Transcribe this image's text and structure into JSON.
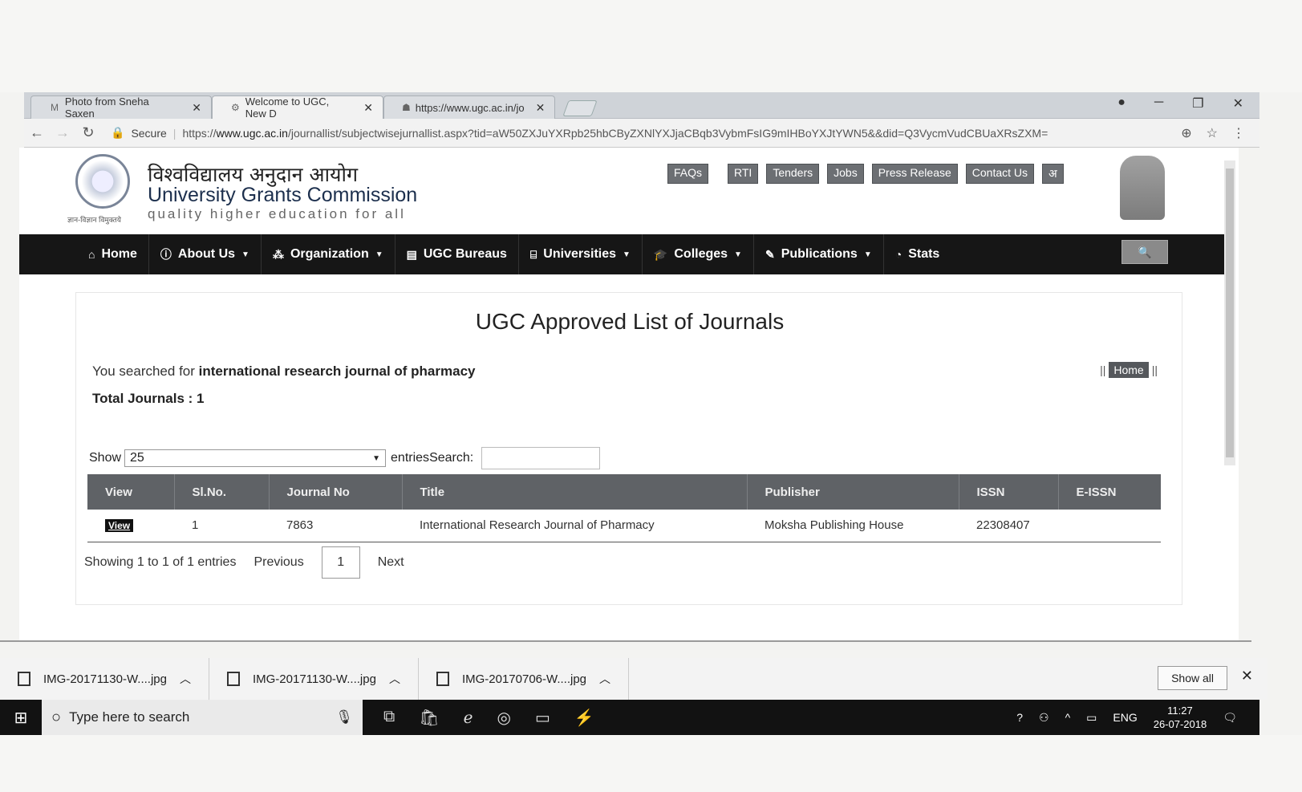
{
  "browser": {
    "tabs": [
      {
        "favicon": "M",
        "label": "Photo from Sneha Saxen",
        "active": false
      },
      {
        "favicon": "gear-icon",
        "label": "Welcome to UGC, New D",
        "active": true
      },
      {
        "favicon": "page-icon",
        "label": "https://www.ugc.ac.in/jo",
        "active": false
      }
    ],
    "secure_label": "Secure",
    "url_prefix": "https://",
    "url_host": "www.ugc.ac.in",
    "url_path": "/journallist/subjectwisejurnallist.aspx?tid=aW50ZXJuYXRpb25hbCByZXNlYXJjaCBqb3VybmFsIG9mIHBoYXJtYWN5&&did=Q3VycmVudCBUaXRsZXM="
  },
  "header": {
    "org_hindi": "विश्वविद्यालय अनुदान आयोग",
    "org_english": "University Grants Commission",
    "tagline": "quality higher education for all",
    "emblem_caption": "ज्ञान-विज्ञान विमुक्तये",
    "toplinks": [
      "FAQs",
      "RTI",
      "Tenders",
      "Jobs",
      "Press Release",
      "Contact Us",
      "अ"
    ]
  },
  "nav": {
    "items": [
      {
        "label": "Home",
        "icon": "home-icon",
        "dropdown": false
      },
      {
        "label": "About Us",
        "icon": "info-icon",
        "dropdown": true
      },
      {
        "label": "Organization",
        "icon": "sitemap-icon",
        "dropdown": true
      },
      {
        "label": "UGC Bureaus",
        "icon": "book-icon",
        "dropdown": false
      },
      {
        "label": "Universities",
        "icon": "university-icon",
        "dropdown": true
      },
      {
        "label": "Colleges",
        "icon": "graduation-cap-icon",
        "dropdown": true
      },
      {
        "label": "Publications",
        "icon": "publication-icon",
        "dropdown": true
      },
      {
        "label": "Stats",
        "icon": "pie-chart-icon",
        "dropdown": false
      }
    ]
  },
  "content": {
    "title": "UGC Approved List of Journals",
    "searched_prefix": "You searched for",
    "searched_query": "international research journal of pharmacy",
    "home_button": "Home",
    "total_label": "Total Journals : 1",
    "show_label": "Show",
    "show_value": "25",
    "entries_label": "entries",
    "search_label": "Search:",
    "search_value": "",
    "table": {
      "columns": [
        "View",
        "Sl.No.",
        "Journal No",
        "Title",
        "Publisher",
        "ISSN",
        "E-ISSN"
      ],
      "rows": [
        {
          "view": "View",
          "slno": "1",
          "journal_no": "7863",
          "title": "International Research Journal of Pharmacy",
          "publisher": "Moksha Publishing House",
          "issn": "22308407",
          "eissn": ""
        }
      ]
    },
    "showing": "Showing 1 to 1 of 1 entries",
    "previous": "Previous",
    "page": "1",
    "next": "Next"
  },
  "downloads": {
    "items": [
      "IMG-20171130-W....jpg",
      "IMG-20171130-W....jpg",
      "IMG-20170706-W....jpg"
    ],
    "show_all": "Show all"
  },
  "taskbar": {
    "search_placeholder": "Type here to search",
    "lang": "ENG",
    "time": "11:27",
    "date": "26-07-2018"
  }
}
